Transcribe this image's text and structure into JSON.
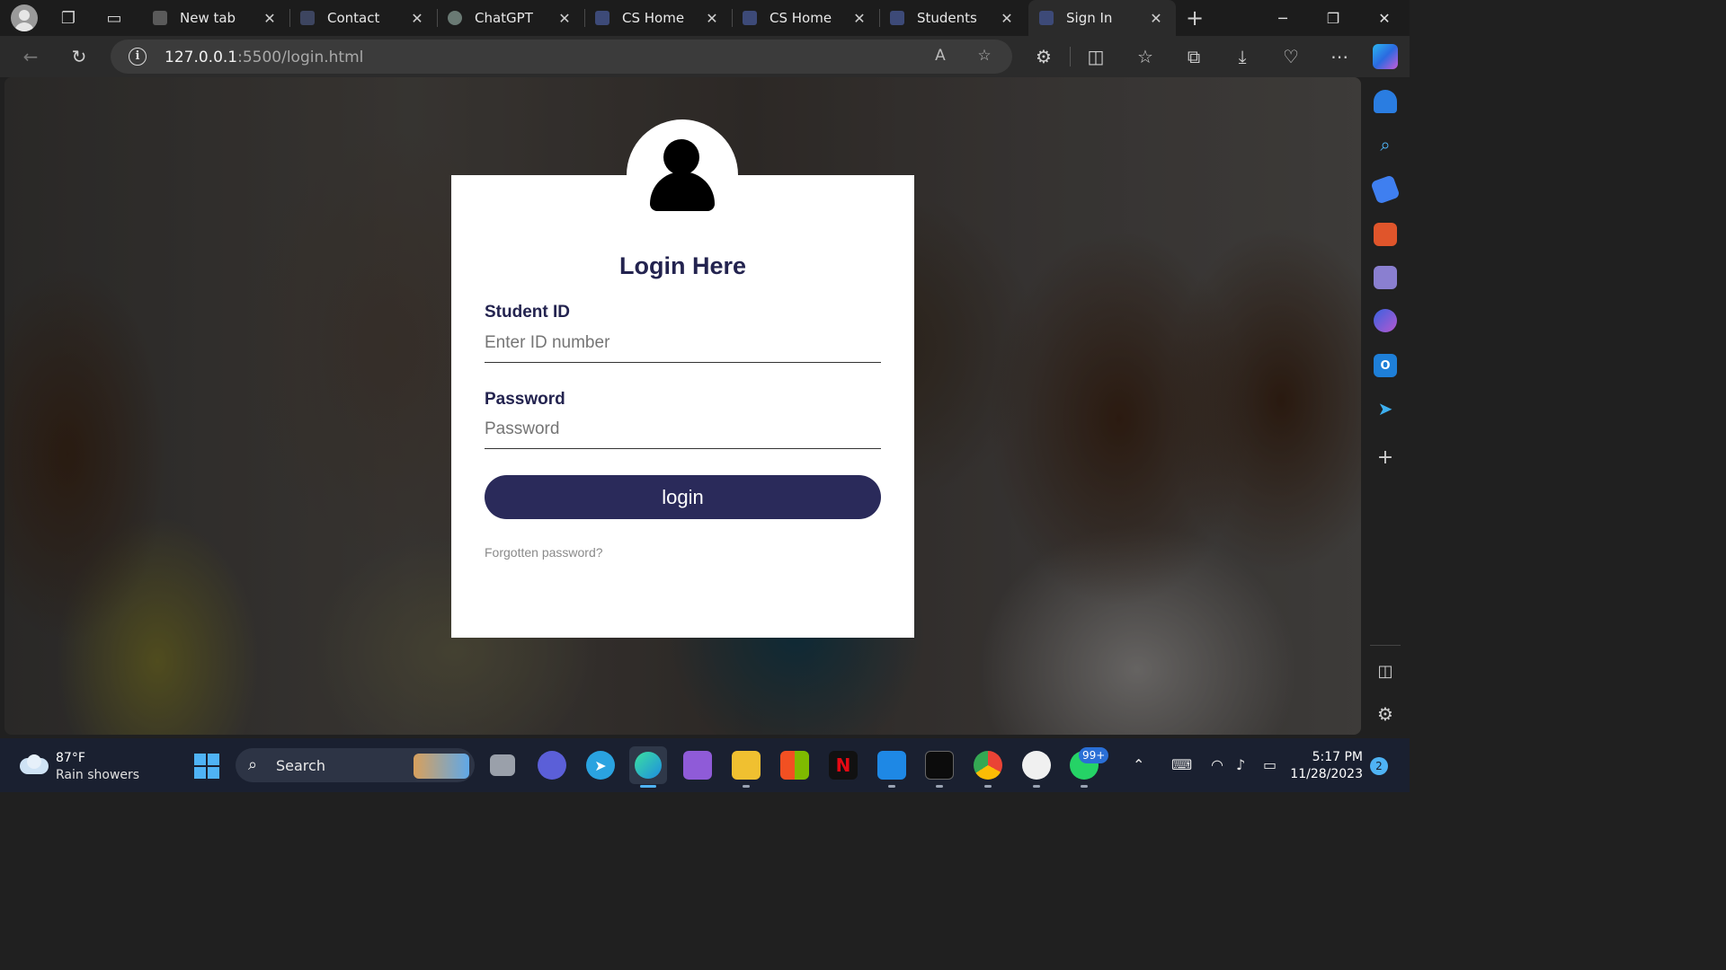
{
  "browser": {
    "tabs": [
      {
        "label": "New tab",
        "icon": "new-tab-icon",
        "color": "#5a5a5a"
      },
      {
        "label": "Contact",
        "icon": "site-icon",
        "color": "#3d4560"
      },
      {
        "label": "ChatGPT",
        "icon": "chatgpt-icon",
        "color": "#6a7a74"
      },
      {
        "label": "CS Home",
        "icon": "site-icon",
        "color": "#3d4a78"
      },
      {
        "label": "CS Home",
        "icon": "site-icon",
        "color": "#3d4a78"
      },
      {
        "label": "Students",
        "icon": "site-icon",
        "color": "#3d4a78"
      },
      {
        "label": "Sign In",
        "icon": "site-icon",
        "color": "#3d4a78",
        "active": true
      }
    ],
    "close_glyph": "✕",
    "new_tab_glyph": "+",
    "address": {
      "host": "127.0.0.1",
      "path": ":5500/login.html"
    }
  },
  "login": {
    "title": "Login Here",
    "student_id_label": "Student ID",
    "student_id_placeholder": "Enter ID number",
    "password_label": "Password",
    "password_placeholder": "Password",
    "button": "login",
    "forgot": "Forgotten password?",
    "accent": "#2a2a5a"
  },
  "taskbar": {
    "weather": {
      "temp": "87°F",
      "desc": "Rain showers"
    },
    "search_label": "Search",
    "badge": "99+",
    "clock": {
      "time": "5:17 PM",
      "date": "11/28/2023"
    },
    "notification_count": "2"
  }
}
